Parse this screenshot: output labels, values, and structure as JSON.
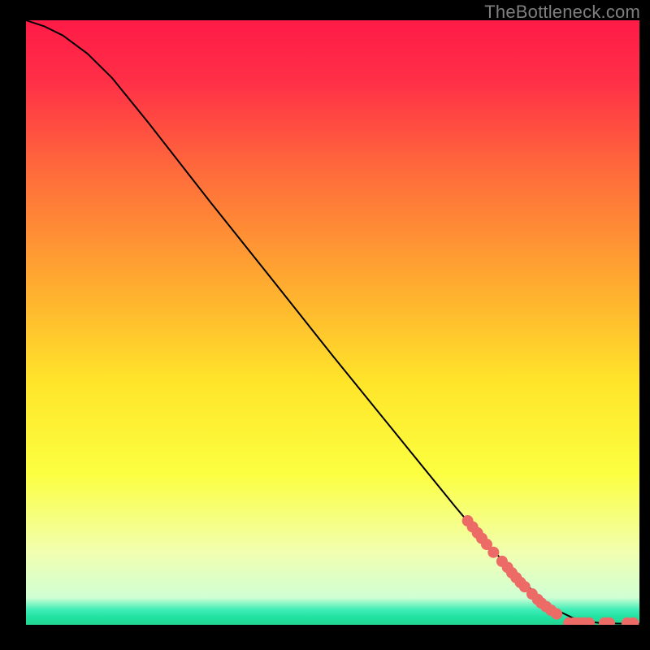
{
  "watermark": "TheBottleneck.com",
  "colors": {
    "bg": "#000000",
    "line": "#000000",
    "marker": "#ec6b66"
  },
  "chart_data": {
    "type": "line",
    "title": "",
    "xlabel": "",
    "ylabel": "",
    "xlim": [
      0,
      100
    ],
    "ylim": [
      0,
      100
    ],
    "grid": false,
    "gradient_stops": [
      {
        "pos": 0.0,
        "color": "#ff1b47"
      },
      {
        "pos": 0.1,
        "color": "#ff2f47"
      },
      {
        "pos": 0.25,
        "color": "#ff6b3b"
      },
      {
        "pos": 0.45,
        "color": "#ffb02f"
      },
      {
        "pos": 0.6,
        "color": "#ffe52a"
      },
      {
        "pos": 0.75,
        "color": "#fcff40"
      },
      {
        "pos": 0.88,
        "color": "#f1ffb0"
      },
      {
        "pos": 0.955,
        "color": "#d0ffd4"
      },
      {
        "pos": 0.975,
        "color": "#3fedb6"
      },
      {
        "pos": 0.988,
        "color": "#1fe2a0"
      },
      {
        "pos": 1.0,
        "color": "#22d58e"
      }
    ],
    "curve": [
      {
        "x": 0,
        "y": 100
      },
      {
        "x": 3,
        "y": 99
      },
      {
        "x": 6,
        "y": 97.5
      },
      {
        "x": 10,
        "y": 94.5
      },
      {
        "x": 14,
        "y": 90.5
      },
      {
        "x": 20,
        "y": 83
      },
      {
        "x": 30,
        "y": 70
      },
      {
        "x": 40,
        "y": 57.3
      },
      {
        "x": 50,
        "y": 44.5
      },
      {
        "x": 60,
        "y": 32
      },
      {
        "x": 70,
        "y": 19.5
      },
      {
        "x": 74,
        "y": 14.7
      },
      {
        "x": 78,
        "y": 10.3
      },
      {
        "x": 82,
        "y": 6.2
      },
      {
        "x": 85,
        "y": 3.6
      },
      {
        "x": 87,
        "y": 2.2
      },
      {
        "x": 89,
        "y": 1.2
      },
      {
        "x": 91,
        "y": 0.6
      },
      {
        "x": 94,
        "y": 0.25
      },
      {
        "x": 100,
        "y": 0.15
      }
    ],
    "markers": [
      {
        "x": 72.0,
        "y": 17.2
      },
      {
        "x": 72.8,
        "y": 16.2
      },
      {
        "x": 73.6,
        "y": 15.2
      },
      {
        "x": 74.3,
        "y": 14.3
      },
      {
        "x": 75.1,
        "y": 13.3
      },
      {
        "x": 76.2,
        "y": 12.0
      },
      {
        "x": 77.6,
        "y": 10.5
      },
      {
        "x": 78.5,
        "y": 9.5
      },
      {
        "x": 79.2,
        "y": 8.6
      },
      {
        "x": 79.9,
        "y": 7.8
      },
      {
        "x": 80.6,
        "y": 7.0
      },
      {
        "x": 81.3,
        "y": 6.3
      },
      {
        "x": 82.5,
        "y": 5.1
      },
      {
        "x": 83.4,
        "y": 4.2
      },
      {
        "x": 84.0,
        "y": 3.6
      },
      {
        "x": 84.8,
        "y": 3.0
      },
      {
        "x": 85.6,
        "y": 2.4
      },
      {
        "x": 86.5,
        "y": 1.8
      },
      {
        "x": 88.5,
        "y": 0.3
      },
      {
        "x": 89.3,
        "y": 0.3
      },
      {
        "x": 90.2,
        "y": 0.3
      },
      {
        "x": 91.0,
        "y": 0.3
      },
      {
        "x": 91.8,
        "y": 0.3
      },
      {
        "x": 94.3,
        "y": 0.3
      },
      {
        "x": 95.1,
        "y": 0.3
      },
      {
        "x": 98.0,
        "y": 0.3
      },
      {
        "x": 99.0,
        "y": 0.3
      }
    ]
  }
}
